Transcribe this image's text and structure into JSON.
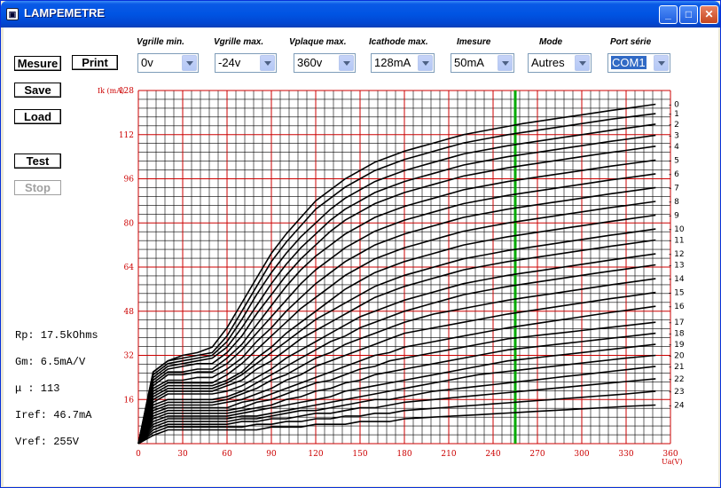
{
  "window": {
    "title": "LAMPEMETRE",
    "app_icon": "tube-app-icon"
  },
  "buttons": {
    "mesure": "Mesure",
    "print": "Print",
    "save": "Save",
    "load": "Load",
    "test": "Test",
    "stop": "Stop"
  },
  "controls": [
    {
      "label": "Vgrille min.",
      "value": "0v"
    },
    {
      "label": "Vgrille max.",
      "value": "-24v"
    },
    {
      "label": "Vplaque max.",
      "value": "360v"
    },
    {
      "label": "Icathode max.",
      "value": "128mA"
    },
    {
      "label": "Imesure",
      "value": "50mA"
    },
    {
      "label": "Mode",
      "value": "Autres"
    },
    {
      "label": "Port série",
      "value": "COM1"
    }
  ],
  "readouts": {
    "rp": "Rp: 17.5kOhms",
    "gm": "Gm: 6.5mA/V",
    "mu": "μ : 113",
    "iref": "Iref: 46.7mA",
    "vref": "Vref: 255V"
  },
  "colors": {
    "grid_major": "#cc0000",
    "grid_minor": "#000000",
    "curves": "#000000",
    "cursor": "#00aa00",
    "axis_labels": "#cc0000"
  },
  "chart_data": {
    "type": "line",
    "xlabel": "Ua(V)",
    "ylabel": "Ik (mA)",
    "xlim": [
      0,
      360
    ],
    "ylim": [
      0,
      128
    ],
    "x_ticks": [
      0,
      30,
      60,
      90,
      120,
      150,
      180,
      210,
      240,
      270,
      300,
      330,
      360
    ],
    "y_ticks": [
      16,
      32,
      48,
      64,
      80,
      96,
      112,
      128
    ],
    "cursor_x": 255,
    "grid": true,
    "x": [
      0,
      10,
      20,
      30,
      40,
      50,
      60,
      70,
      80,
      90,
      100,
      110,
      120,
      130,
      140,
      150,
      160,
      170,
      180,
      190,
      200,
      210,
      220,
      230,
      240,
      250,
      260,
      270,
      280,
      290,
      300,
      310,
      320,
      330,
      350
    ],
    "series": [
      {
        "name": "0",
        "values": [
          0,
          26,
          30,
          32,
          33,
          35,
          42,
          51,
          60,
          69,
          76,
          82,
          88,
          92,
          96,
          99,
          102,
          104,
          106,
          107.5,
          109,
          110.5,
          112,
          113,
          114,
          115,
          116,
          116.8,
          117.6,
          118.4,
          119.2,
          120,
          120.8,
          121.5,
          123
        ]
      },
      {
        "name": "1",
        "values": [
          0,
          26,
          30,
          31,
          32,
          33,
          39,
          48,
          57,
          66,
          73,
          79,
          85,
          89,
          93,
          96,
          99,
          101,
          103,
          104.5,
          106,
          107.5,
          109,
          110,
          111,
          112,
          112.8,
          113.6,
          114.4,
          115.2,
          116,
          116.8,
          117.6,
          118.3,
          119.6
        ]
      },
      {
        "name": "2",
        "values": [
          0,
          25,
          29,
          30,
          31,
          32,
          37,
          45,
          54,
          62,
          69,
          75,
          80,
          85,
          89,
          92,
          95,
          97,
          99,
          100.5,
          102,
          103.5,
          105,
          106,
          107,
          108,
          108.8,
          109.6,
          110.4,
          111.2,
          112,
          112.8,
          113.6,
          114.3,
          115.8
        ]
      },
      {
        "name": "3",
        "values": [
          0,
          24,
          28,
          29,
          30,
          31,
          35,
          42,
          50,
          58,
          65,
          71,
          76,
          81,
          85,
          88,
          91,
          93,
          95,
          96.5,
          98,
          99.5,
          101,
          102,
          103,
          104,
          104.8,
          105.6,
          106.4,
          107.2,
          108,
          108.8,
          109.6,
          110.3,
          111.8
        ]
      },
      {
        "name": "4",
        "values": [
          0,
          23,
          27,
          28,
          29,
          29,
          33,
          39,
          47,
          54,
          61,
          67,
          72,
          77,
          81,
          84,
          87,
          89,
          91,
          92.5,
          94,
          95.5,
          97,
          98,
          99,
          100,
          100.8,
          101.6,
          102.4,
          103.2,
          104,
          104.8,
          105.6,
          106.3,
          107.8
        ]
      },
      {
        "name": "5",
        "values": [
          0,
          22,
          26,
          26,
          27,
          27,
          31,
          36,
          43,
          50,
          57,
          63,
          68,
          72,
          76,
          79,
          82,
          84,
          86,
          87.5,
          89,
          90.5,
          92,
          93,
          94,
          95,
          95.8,
          96.6,
          97.4,
          98.2,
          99,
          99.8,
          100.6,
          101.3,
          102.8
        ]
      },
      {
        "name": "6",
        "values": [
          0,
          21,
          25,
          25,
          26,
          26,
          29,
          34,
          40,
          46,
          52,
          58,
          63,
          67,
          71,
          74,
          77,
          79,
          81,
          82.5,
          84,
          85.5,
          87,
          88,
          89,
          90,
          90.8,
          91.6,
          92.4,
          93.2,
          94,
          94.8,
          95.6,
          96.3,
          97.8
        ]
      },
      {
        "name": "7",
        "values": [
          0,
          20,
          23,
          23,
          24,
          24,
          27,
          31,
          37,
          42,
          48,
          53,
          58,
          62,
          66,
          69,
          72,
          74,
          76,
          77.5,
          79,
          80.5,
          82,
          83,
          84,
          85,
          85.8,
          86.6,
          87.4,
          88.2,
          89,
          89.8,
          90.6,
          91.3,
          92.8
        ]
      },
      {
        "name": "8",
        "values": [
          0,
          19,
          22,
          22,
          22,
          22,
          25,
          29,
          34,
          39,
          44,
          49,
          53,
          57,
          61,
          64,
          67,
          69,
          71,
          72.5,
          74,
          75.5,
          77,
          78,
          79,
          80,
          80.8,
          81.6,
          82.4,
          83.2,
          84,
          84.8,
          85.6,
          86.3,
          87.8
        ]
      },
      {
        "name": "9",
        "values": [
          0,
          18,
          21,
          21,
          21,
          21,
          23,
          26,
          31,
          35,
          40,
          44,
          48,
          52,
          56,
          59,
          62,
          64,
          66,
          67.5,
          69,
          70.5,
          72,
          73,
          74,
          75,
          75.8,
          76.6,
          77.4,
          78.2,
          79,
          79.8,
          80.6,
          81.3,
          82.8
        ]
      },
      {
        "name": "10",
        "values": [
          0,
          17,
          20,
          20,
          20,
          20,
          22,
          25,
          29,
          33,
          37,
          41,
          45,
          48,
          51,
          54,
          57,
          59,
          61,
          62.5,
          64,
          65.5,
          67,
          68,
          69,
          70,
          70.8,
          71.6,
          72.4,
          73.2,
          74,
          74.8,
          75.6,
          76.3,
          77.8
        ]
      },
      {
        "name": "11",
        "values": [
          0,
          16,
          19,
          19,
          19,
          19,
          21,
          23,
          27,
          30,
          34,
          38,
          41,
          44,
          47,
          50,
          53,
          55,
          57,
          58.5,
          60,
          61.5,
          63,
          64,
          65,
          66,
          66.8,
          67.6,
          68.4,
          69.2,
          70,
          70.8,
          71.6,
          72.3,
          73.8
        ]
      },
      {
        "name": "12",
        "values": [
          0,
          15,
          18,
          18,
          18,
          18,
          19,
          21,
          24,
          27,
          31,
          34,
          37,
          40,
          43,
          46,
          48,
          50,
          52,
          53.5,
          55,
          56.5,
          58,
          59,
          60,
          61,
          61.8,
          62.6,
          63.4,
          64.2,
          65,
          65.8,
          66.6,
          67.3,
          68.8
        ]
      },
      {
        "name": "13",
        "values": [
          0,
          14,
          16,
          16,
          16,
          16,
          17,
          19,
          22,
          25,
          28,
          31,
          34,
          37,
          39,
          42,
          44,
          46,
          48,
          49.5,
          51,
          52.5,
          54,
          55,
          56,
          57,
          57.8,
          58.6,
          59.4,
          60.2,
          61,
          61.8,
          62.6,
          63.3,
          64.8
        ]
      },
      {
        "name": "14",
        "values": [
          0,
          13,
          15,
          15,
          15,
          15,
          16,
          18,
          20,
          23,
          25,
          28,
          31,
          33,
          36,
          38,
          40,
          42,
          44,
          45.5,
          47,
          48,
          49,
          50,
          51,
          52,
          52.8,
          53.6,
          54.4,
          55.2,
          56,
          56.8,
          57.6,
          58.3,
          59.8
        ]
      },
      {
        "name": "15",
        "values": [
          0,
          12,
          14,
          14,
          14,
          14,
          15,
          16,
          18,
          20,
          23,
          25,
          28,
          30,
          32,
          34,
          36,
          38,
          40,
          41,
          42,
          43,
          44,
          45,
          46,
          47,
          47.8,
          48.6,
          49.4,
          50.2,
          51,
          51.8,
          52.6,
          53.3,
          54.8
        ]
      },
      {
        "name": "16",
        "values": [
          0,
          11,
          13,
          13,
          13,
          13,
          13,
          15,
          16,
          18,
          20,
          22,
          24,
          26,
          28,
          30,
          32,
          33,
          35,
          36,
          37,
          38,
          39,
          40,
          41,
          42,
          42.8,
          43.6,
          44.4,
          45.2,
          46,
          46.8,
          47.6,
          48.3,
          49.8
        ]
      },
      {
        "name": "17",
        "values": [
          0,
          10,
          12,
          12,
          12,
          12,
          12,
          13,
          15,
          16,
          18,
          20,
          22,
          23,
          25,
          27,
          28,
          30,
          31,
          32,
          33,
          34,
          35,
          36,
          37,
          38,
          38.6,
          39.2,
          39.8,
          40.4,
          41,
          41.6,
          42.2,
          42.8,
          44
        ]
      },
      {
        "name": "18",
        "values": [
          0,
          9,
          11,
          11,
          11,
          11,
          11,
          12,
          13,
          14,
          16,
          17,
          19,
          20,
          22,
          23,
          25,
          26,
          27,
          28,
          29,
          30,
          31,
          32,
          33,
          34,
          34.6,
          35.2,
          35.8,
          36.4,
          37,
          37.6,
          38.2,
          38.8,
          40
        ]
      },
      {
        "name": "19",
        "values": [
          0,
          8,
          10,
          10,
          10,
          10,
          10,
          11,
          12,
          13,
          14,
          15,
          16,
          17,
          19,
          20,
          21,
          22,
          23,
          24,
          25,
          26,
          27,
          28,
          29,
          30,
          30.6,
          31.2,
          31.8,
          32.4,
          33,
          33.6,
          34.2,
          34.8,
          36
        ]
      },
      {
        "name": "20",
        "values": [
          0,
          7,
          9,
          9,
          9,
          9,
          9,
          10,
          10,
          11,
          12,
          13,
          14,
          15,
          16,
          17,
          18,
          19,
          20,
          21,
          22,
          23,
          24,
          25,
          25.6,
          26.2,
          26.8,
          27.4,
          28,
          28.6,
          29.2,
          29.8,
          30.4,
          31,
          32
        ]
      },
      {
        "name": "21",
        "values": [
          0,
          6,
          8,
          8,
          8,
          8,
          8,
          9,
          9,
          10,
          11,
          12,
          12,
          13,
          14,
          15,
          16,
          16,
          17,
          18,
          19,
          19.6,
          20.2,
          20.8,
          21.4,
          22,
          22.6,
          23.2,
          23.8,
          24.4,
          25,
          25.6,
          26.2,
          26.8,
          28
        ]
      },
      {
        "name": "22",
        "values": [
          0,
          5,
          7,
          7,
          7,
          7,
          7,
          8,
          8,
          9,
          9,
          10,
          11,
          11,
          12,
          13,
          13,
          14,
          15,
          15.5,
          16,
          16.5,
          17,
          17.5,
          18,
          18.5,
          19,
          19.5,
          20,
          20.5,
          21,
          21.5,
          22,
          22.5,
          23.5
        ]
      },
      {
        "name": "23",
        "values": [
          0,
          4,
          6,
          6,
          6,
          6,
          6,
          6,
          7,
          7,
          8,
          8,
          9,
          9,
          10,
          10,
          11,
          11,
          12,
          12.4,
          12.8,
          13.2,
          13.6,
          14,
          14.4,
          14.8,
          15.2,
          15.6,
          16,
          16.4,
          16.8,
          17.2,
          17.6,
          18,
          19
        ]
      },
      {
        "name": "24",
        "values": [
          0,
          3,
          5,
          5,
          5,
          5,
          5,
          5,
          5,
          6,
          6,
          6,
          7,
          7,
          7,
          8,
          8,
          8,
          9,
          9.3,
          9.6,
          9.9,
          10.2,
          10.5,
          10.8,
          11.1,
          11.4,
          11.7,
          12,
          12.3,
          12.6,
          12.9,
          13.2,
          13.5,
          14
        ]
      }
    ]
  }
}
